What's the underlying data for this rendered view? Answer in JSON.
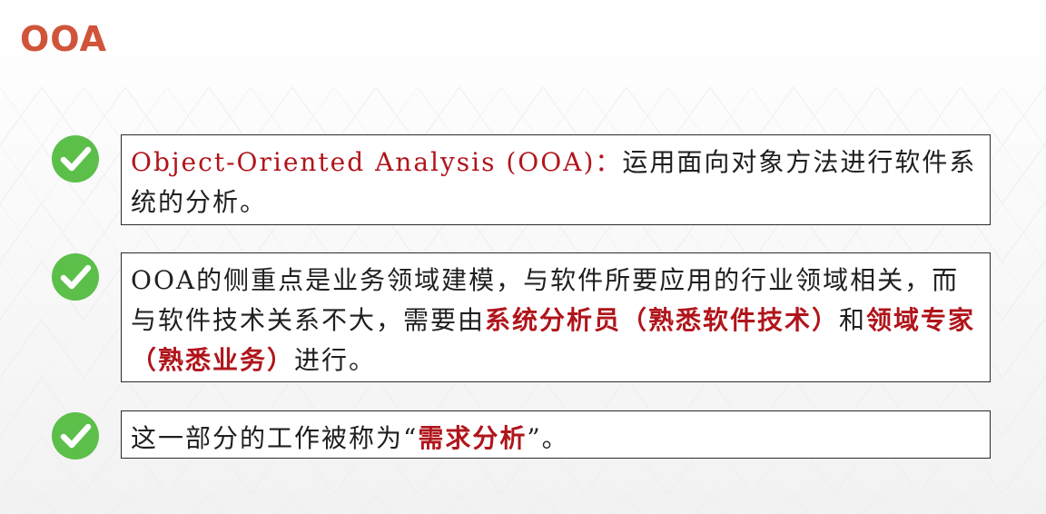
{
  "slide": {
    "title": "OOA"
  },
  "items": [
    {
      "icon": "check-icon",
      "seg1": "Object-Oriented Analysis (OOA)：",
      "seg2": "运用面向对象方法进行软件系统的分析。"
    },
    {
      "icon": "check-icon",
      "seg1": "OOA的侧重点是业务领域建模，与软件所要应用的行业领域相关，而与软件技术关系不大，需要由",
      "seg2": "系统分析员（熟悉软件技术）",
      "seg3": "和",
      "seg4": "领域专家（熟悉业务）",
      "seg5": "进行。"
    },
    {
      "icon": "check-icon",
      "seg1": "这一部分的工作被称为“",
      "seg2": "需求分析",
      "seg3": "”。"
    }
  ],
  "colors": {
    "title": "#d0543a",
    "check": "#5cbf4a",
    "highlight": "#b0151b"
  }
}
